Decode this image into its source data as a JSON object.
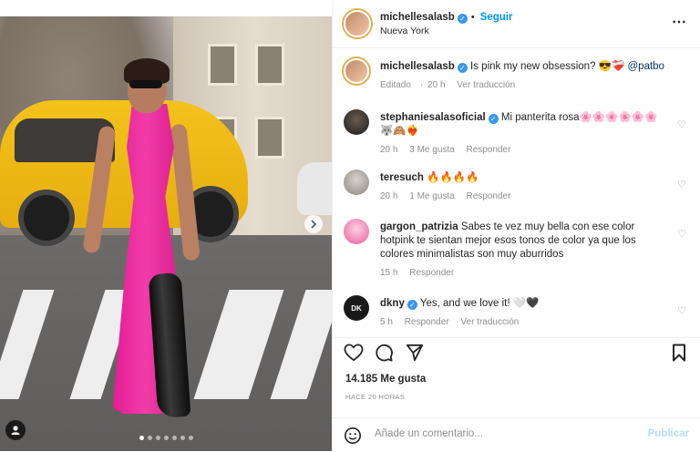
{
  "header": {
    "username": "michellesalasb",
    "separator": "•",
    "follow_label": "Seguir",
    "location": "Nueva York",
    "more_icon": "⋯"
  },
  "caption": {
    "username": "michellesalasb",
    "text": "Is pink my new obsession? 😎❤️‍🩹",
    "mention": "@patbo",
    "edited": "Editado",
    "time": "20 h",
    "translate": "Ver traducción"
  },
  "comments": [
    {
      "username": "stephaniesalasoficial",
      "verified": true,
      "text": "Mi panterita rosa🌸🌸🌸🌸🌸🌸🐺🙈❤️‍🔥",
      "time": "20 h",
      "likes": "3 Me gusta",
      "reply": "Responder"
    },
    {
      "username": "teresuch",
      "verified": false,
      "text": "🔥🔥🔥🔥",
      "time": "20 h",
      "likes": "1 Me gusta",
      "reply": "Responder"
    },
    {
      "username": "gargon_patrizia",
      "verified": false,
      "text": "Sabes te vez muy bella con ese color hotpink te sientan mejor esos tonos de color ya que los colores minimalistas son muy aburridos",
      "time": "15 h",
      "reply": "Responder"
    },
    {
      "username": "dkny",
      "verified": true,
      "text": "Yes, and we love it! 🤍🖤",
      "time": "5 h",
      "reply": "Responder",
      "translate": "Ver traducción"
    }
  ],
  "likes_count": "14.185 Me gusta",
  "posted_time": "HACE 20 HORAS",
  "composer": {
    "placeholder": "Añade un comentario...",
    "publish_label": "Publicar"
  },
  "carousel": {
    "dots": 7,
    "active_dot": 1
  },
  "colors": {
    "accent": "#0095f6",
    "verified": "#3897f0",
    "dress": "#e81c94",
    "taxi": "#f3c21b"
  }
}
